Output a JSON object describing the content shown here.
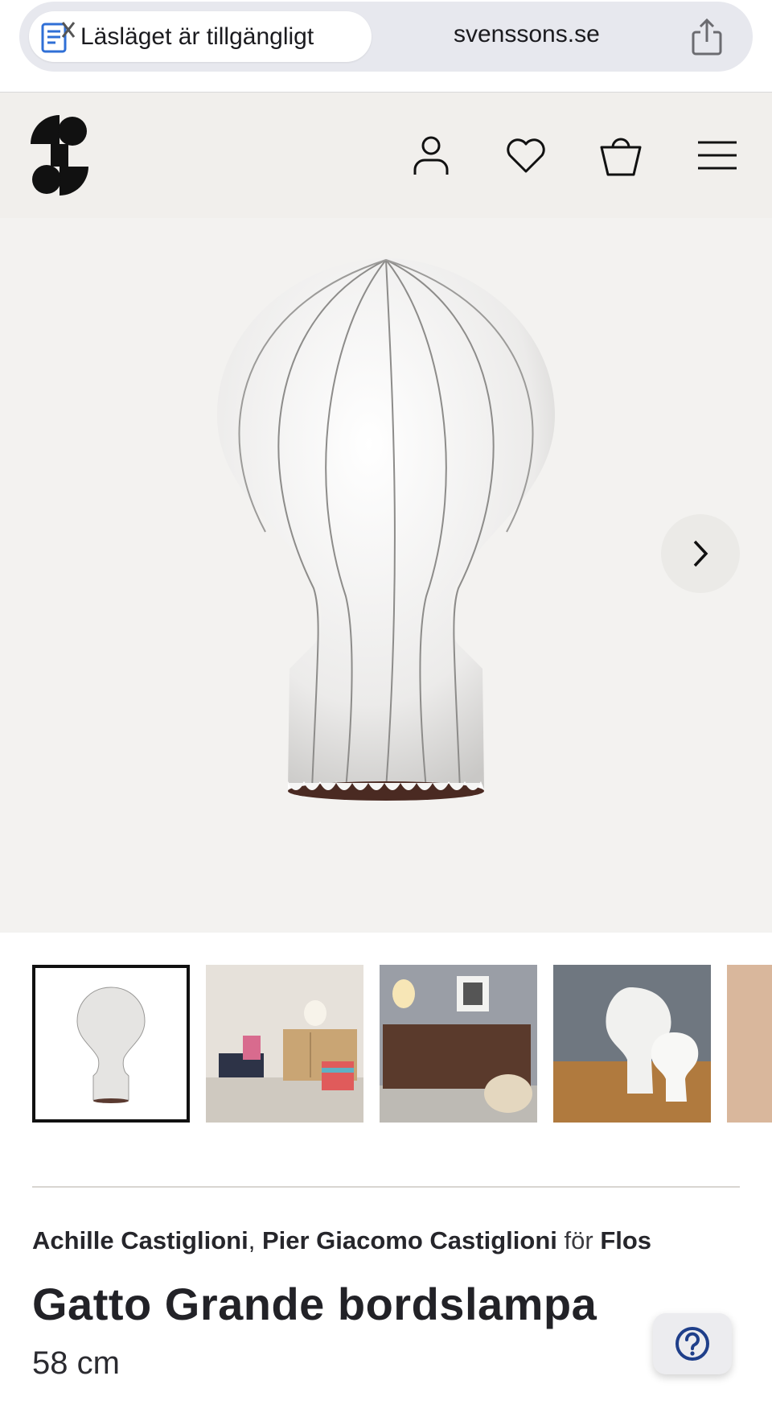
{
  "browser": {
    "reader_label": "Läsläget är tillgängligt",
    "domain": "svenssons.se"
  },
  "product": {
    "designers": [
      "Achille Castiglioni",
      "Pier Giacomo Castiglioni"
    ],
    "designer_separator": ", ",
    "for_word": "för",
    "brand": "Flos",
    "title": "Gatto Grande bordslampa",
    "size": "58 cm"
  },
  "icons": {
    "reader": "reader-mode-icon",
    "share": "share-icon",
    "logo": "svenssons-logo",
    "account": "user-icon",
    "wishlist": "heart-icon",
    "cart": "basket-icon",
    "menu": "hamburger-menu-icon",
    "next": "chevron-right-icon",
    "help": "question-icon"
  },
  "gallery": {
    "selected_index": 0,
    "thumbnail_count": 5
  },
  "colors": {
    "header_bg": "#f1efec",
    "hero_bg": "#f3f2f0",
    "text": "#222227"
  }
}
